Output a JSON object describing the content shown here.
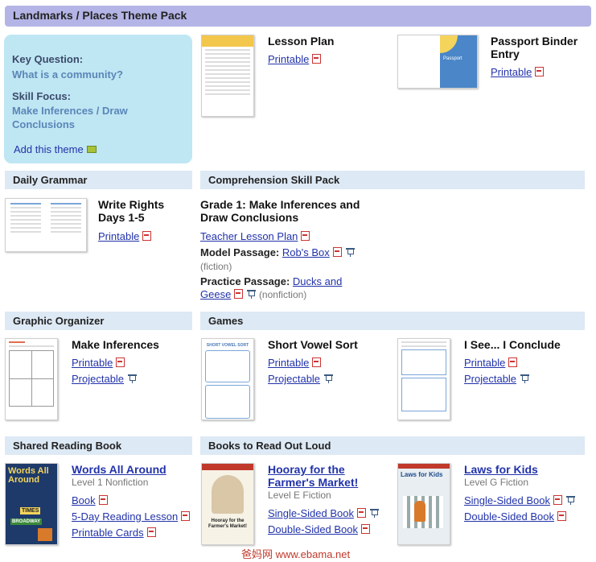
{
  "title": "Landmarks / Places Theme Pack",
  "key": {
    "question_label": "Key Question:",
    "question": "What is a community?",
    "skill_label": "Skill Focus:",
    "skill": "Make Inferences / Draw Conclusions",
    "add_label": "Add this theme"
  },
  "top_items": [
    {
      "title": "Lesson Plan",
      "links": [
        "Printable"
      ]
    },
    {
      "title": "Passport Binder Entry",
      "links": [
        "Printable"
      ]
    }
  ],
  "daily_grammar": {
    "heading": "Daily Grammar",
    "title": "Write Rights Days 1-5",
    "printable": "Printable"
  },
  "comprehension": {
    "heading": "Comprehension Skill Pack",
    "title": "Grade 1: Make Inferences and Draw Conclusions",
    "teacher_plan": "Teacher Lesson Plan",
    "model_label": "Model Passage:",
    "model_link": "Rob's Box",
    "model_note": "(fiction)",
    "practice_label": "Practice Passage:",
    "practice_link": "Ducks and Geese",
    "practice_note": "(nonfiction)"
  },
  "graphic_organizer": {
    "heading": "Graphic Organizer",
    "title": "Make Inferences",
    "printable": "Printable",
    "projectable": "Projectable"
  },
  "games": {
    "heading": "Games",
    "items": [
      {
        "title": "Short Vowel Sort",
        "printable": "Printable",
        "projectable": "Projectable"
      },
      {
        "title": "I See... I Conclude",
        "printable": "Printable",
        "projectable": "Projectable"
      }
    ]
  },
  "shared_reading": {
    "heading": "Shared Reading Book",
    "title": "Words All Around",
    "level": "Level 1 Nonfiction",
    "book": "Book",
    "reading_lesson": "5-Day Reading Lesson",
    "cards": "Printable Cards",
    "cover_text": "Words All Around",
    "signs": [
      "TIMES",
      "BROADWAY"
    ]
  },
  "read_aloud": {
    "heading": "Books to Read Out Loud",
    "items": [
      {
        "title": "Hooray for the Farmer's Market!",
        "level": "Level E Fiction",
        "single": "Single-Sided Book",
        "double": "Double-Sided Book",
        "cover_text": "Hooray for the Farmer's Market!"
      },
      {
        "title": "Laws for Kids",
        "level": "Level G Fiction",
        "single": "Single-Sided Book",
        "double": "Double-Sided Book",
        "cover_text": "Laws for Kids"
      }
    ]
  },
  "thumb_text": {
    "passport": "Passport",
    "short_vowel": "SHORT VOWEL SORT"
  },
  "watermark": "爸妈网 www.ebama.net",
  "colors": {
    "header": "#b4b4e6",
    "section": "#dde9f5",
    "keybox": "#bfe6f3",
    "link": "#2233aa",
    "accent": "#5a86b8"
  }
}
